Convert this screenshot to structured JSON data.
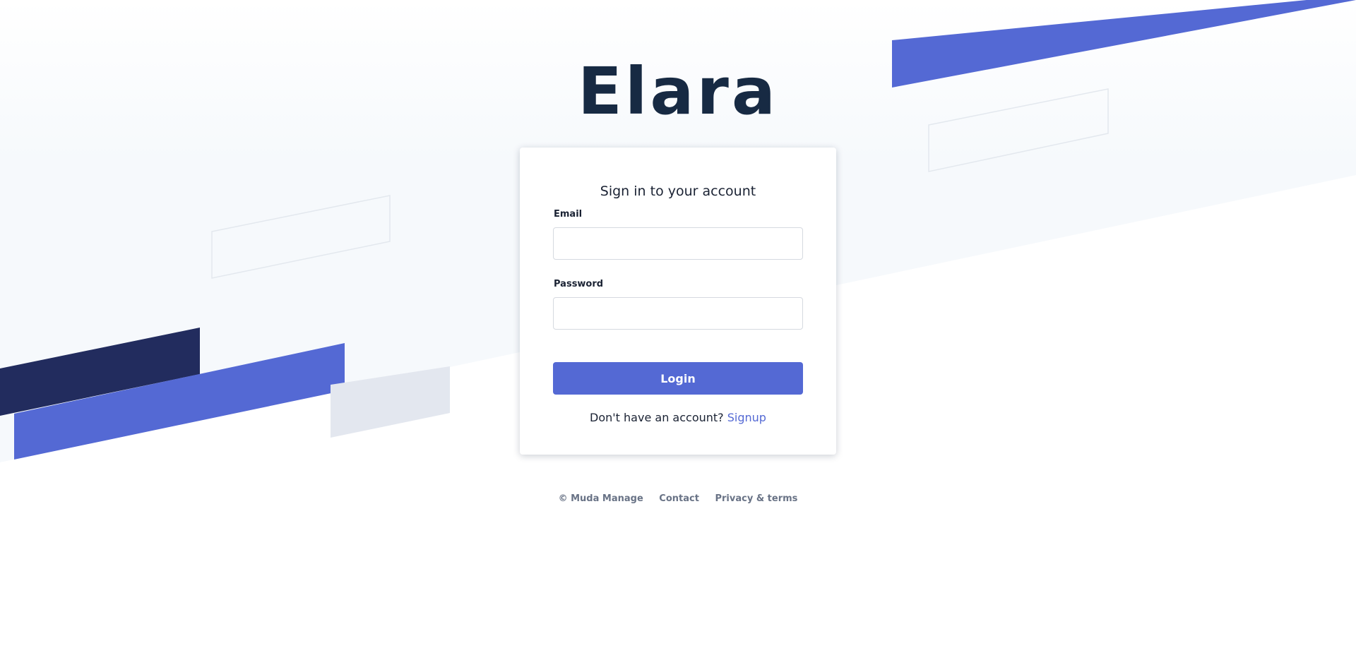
{
  "brand": {
    "logo_text": "Elara"
  },
  "login_card": {
    "title": "Sign in to your account",
    "email_label": "Email",
    "email_value": "",
    "password_label": "Password",
    "password_value": "",
    "login_button": "Login",
    "signup_prompt": "Don't have an account?",
    "signup_link": "Signup"
  },
  "footer": {
    "copyright": "© Muda Manage",
    "contact": "Contact",
    "privacy": "Privacy & terms"
  },
  "colors": {
    "accent": "#5469d4",
    "navy": "#222c5e",
    "logo": "#172a43",
    "background_tint": "#f6f9fc",
    "footer_text": "#697386"
  }
}
